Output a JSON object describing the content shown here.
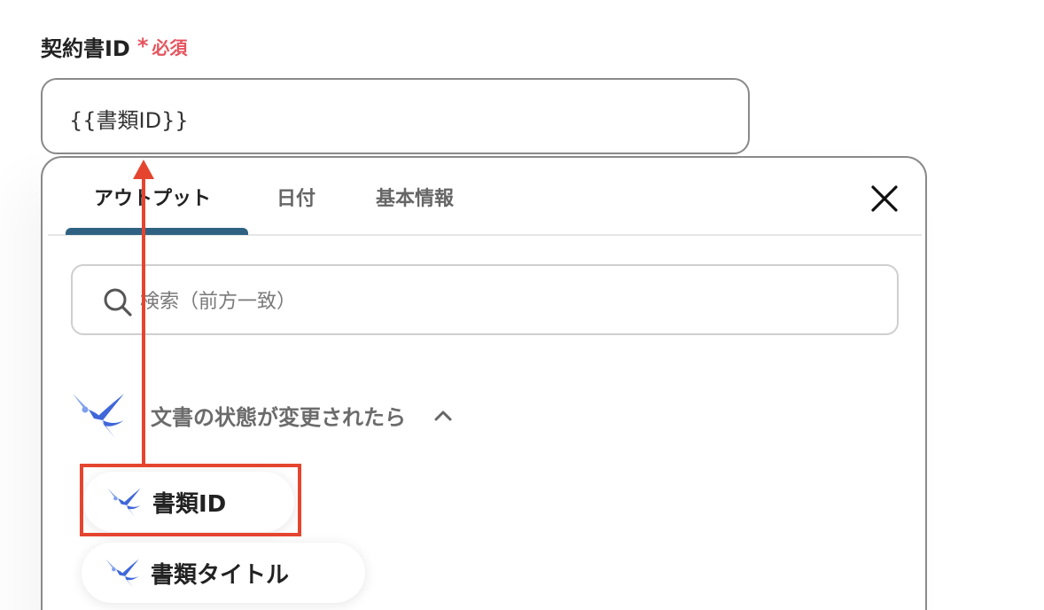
{
  "field": {
    "label": "契約書ID",
    "asterisk": "*",
    "required": "必須",
    "value": "{{書類ID}}"
  },
  "popup": {
    "tabs": [
      {
        "label": "アウトプット",
        "active": true
      },
      {
        "label": "日付",
        "active": false
      },
      {
        "label": "基本情報",
        "active": false
      }
    ],
    "close_icon": "close-icon",
    "search": {
      "placeholder": "検索（前方一致）",
      "value": ""
    },
    "section": {
      "title": "文書の状態が変更されたら",
      "expanded": true,
      "icon": "chevron-up-icon"
    },
    "outputs": [
      {
        "label": "書類ID",
        "highlighted": true
      },
      {
        "label": "書類タイトル",
        "highlighted": false
      }
    ]
  },
  "colors": {
    "accent": "#2f6282",
    "required": "#e5545e",
    "highlight": "#e5452f",
    "logo_blue": "#3f67d9",
    "logo_light": "#7fa0ec"
  }
}
